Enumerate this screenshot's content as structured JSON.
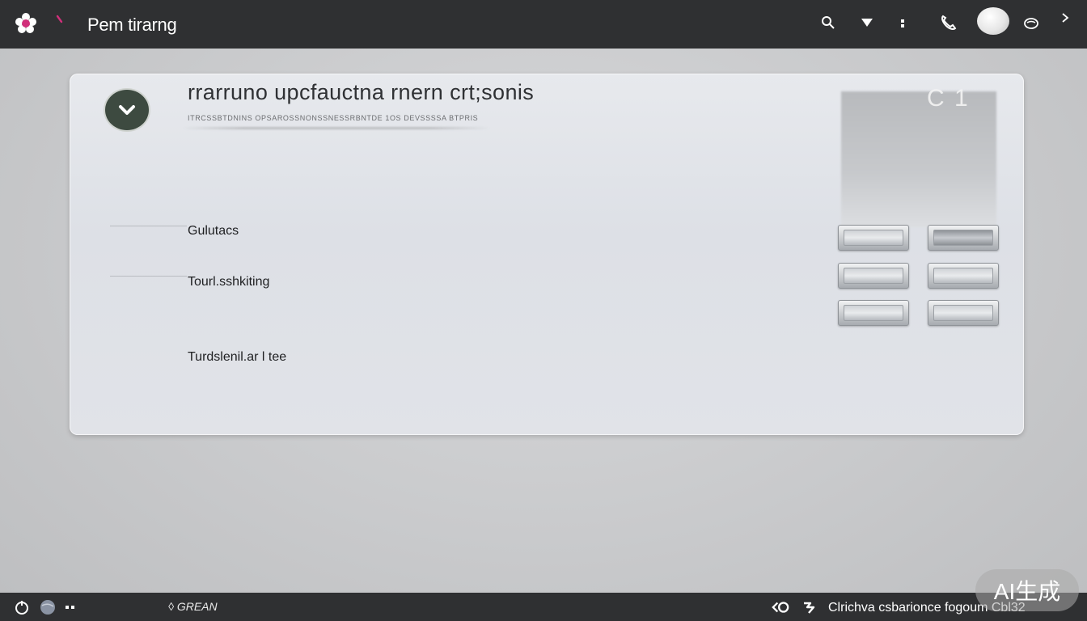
{
  "topbar": {
    "app_title": "Pem tirarng",
    "icons": [
      "app-logo-icon",
      "back-icon",
      "search-icon",
      "filter-icon",
      "more-vertical-icon",
      "phone-icon",
      "avatar",
      "cloud-icon",
      "chevron-right-icon"
    ]
  },
  "card": {
    "title": "rrarruno upcfauctna rnern crt;sonis",
    "subtitle": "ITRCSSBTDNINS OPSAROSSNONSSNESSRBNTDE 1OS DEVSSSSA BTPRIS",
    "preview_glyph": "C 1",
    "rows": [
      {
        "label": "Gulutacs"
      },
      {
        "label": "Tourl.sshkiting"
      },
      {
        "label": "Turdslenil.ar l tee"
      }
    ]
  },
  "bottombar": {
    "brand": "GREAN",
    "status": "Clrichva csbarionce fogoum Cbl32"
  },
  "watermark": "AI生成",
  "colors": {
    "topbar_bg": "#2f3032",
    "logo_accent": "#d12f7a",
    "card_bg": "#e2e4e8",
    "badge_bg": "#3d4a40"
  }
}
